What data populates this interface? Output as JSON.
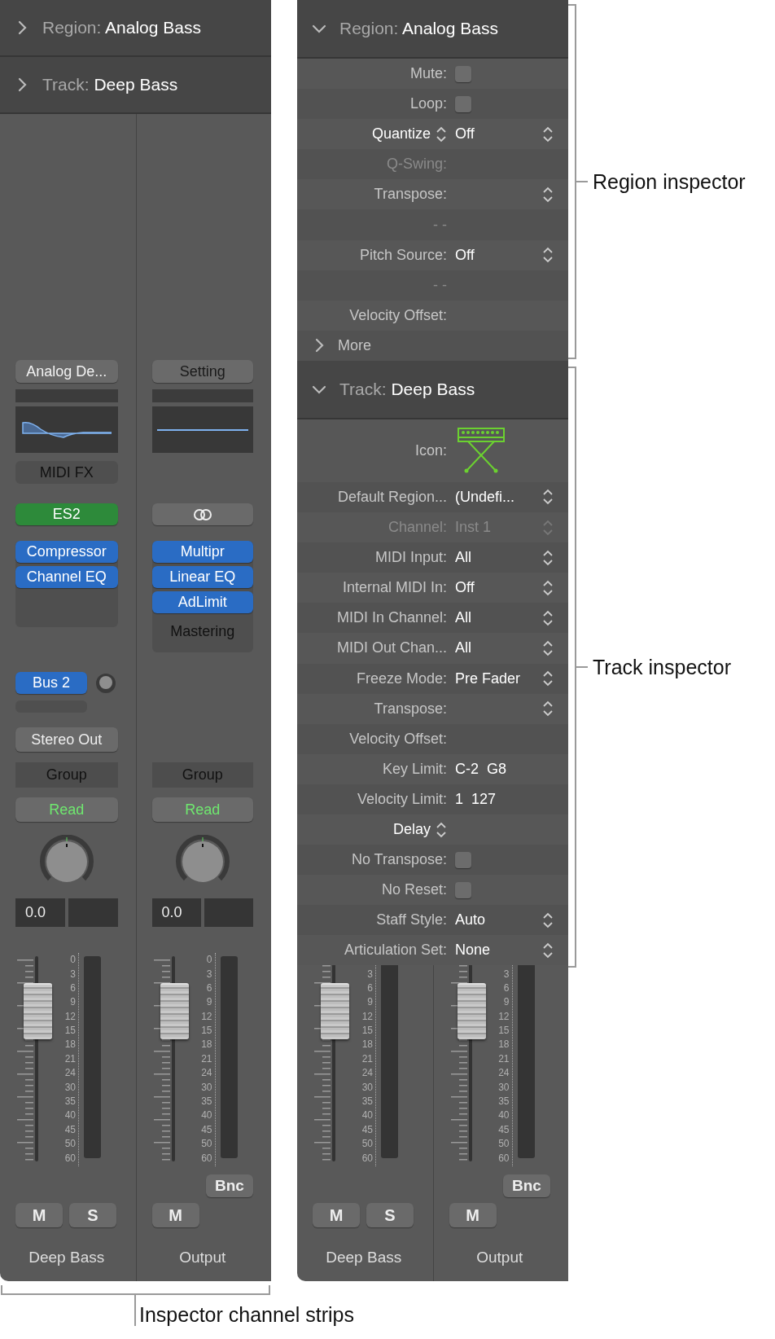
{
  "mixer_panel": {
    "headers": [
      {
        "label": "Region:",
        "title": "Analog Bass",
        "expanded": false
      },
      {
        "label": "Track:",
        "title": "Deep Bass",
        "expanded": false
      }
    ],
    "strips": [
      {
        "preset": {
          "label": "Analog De...",
          "active": true
        },
        "eq": {
          "kind": "curve"
        },
        "midi_fx": "MIDI FX",
        "instrument": {
          "kind": "plugin",
          "label": "ES2"
        },
        "audio_fx": [
          "Compressor",
          "Channel EQ"
        ],
        "send": "Bus 2",
        "output": "Stereo Out",
        "group": "Group",
        "automation": "Read",
        "volume": "0.0",
        "fader": {
          "level": 0.74,
          "scale": [
            "0",
            "3",
            "6",
            "9",
            "12",
            "15",
            "18",
            "21",
            "24",
            "30",
            "35",
            "40",
            "45",
            "50",
            "60"
          ]
        },
        "buttons": [
          "M",
          "S"
        ],
        "name": "Deep Bass"
      },
      {
        "preset": {
          "label": "Setting",
          "active": false
        },
        "eq": {
          "kind": "flat"
        },
        "instrument": {
          "kind": "link"
        },
        "audio_fx": [
          "Multipr",
          "Linear EQ",
          "AdLimit"
        ],
        "fx_footer": "Mastering",
        "group": "Group",
        "automation": "Read",
        "volume": "0.0",
        "fader": {
          "level": 0.74,
          "scale": [
            "0",
            "3",
            "6",
            "9",
            "12",
            "15",
            "18",
            "21",
            "24",
            "30",
            "35",
            "40",
            "45",
            "50",
            "60"
          ]
        },
        "bounce": "Bnc",
        "buttons": [
          "M"
        ],
        "name": "Output"
      }
    ]
  },
  "inspector_panel": {
    "sections": [
      {
        "label": "Region:",
        "title": "Analog Bass",
        "expanded": true,
        "rows": [
          {
            "kind": "checkbox",
            "label": "Mute:",
            "checked": false
          },
          {
            "kind": "checkbox",
            "label": "Loop:",
            "checked": false
          },
          {
            "kind": "label_popup",
            "label": "Quantize",
            "value": "Off"
          },
          {
            "kind": "text",
            "label": "Q-Swing:",
            "disabled": true
          },
          {
            "kind": "popup",
            "label": "Transpose:"
          },
          {
            "kind": "range",
            "label": "- -"
          },
          {
            "kind": "popup",
            "label": "Pitch Source:",
            "value": "Off"
          },
          {
            "kind": "range",
            "label": "- -"
          },
          {
            "kind": "text",
            "label": "Velocity Offset:"
          },
          {
            "kind": "disclosure",
            "label": "More",
            "expanded": false
          }
        ]
      },
      {
        "label": "Track:",
        "title": "Deep Bass",
        "expanded": true,
        "rows": [
          {
            "kind": "icon",
            "label": "Icon:"
          },
          {
            "kind": "popup",
            "label": "Default Region...",
            "value": "(Undefi..."
          },
          {
            "kind": "popup",
            "label": "Channel:",
            "value": "Inst 1",
            "disabled": true
          },
          {
            "kind": "popup",
            "label": "MIDI Input:",
            "value": "All"
          },
          {
            "kind": "popup",
            "label": "Internal MIDI In:",
            "value": "Off"
          },
          {
            "kind": "popup",
            "label": "MIDI In Channel:",
            "value": "All"
          },
          {
            "kind": "popup",
            "label": "MIDI Out Chan...",
            "value": "All"
          },
          {
            "kind": "popup",
            "label": "Freeze Mode:",
            "value": "Pre Fader"
          },
          {
            "kind": "popup",
            "label": "Transpose:"
          },
          {
            "kind": "text",
            "label": "Velocity Offset:"
          },
          {
            "kind": "text",
            "label": "Key Limit:",
            "value": "C-2  G8"
          },
          {
            "kind": "text",
            "label": "Velocity Limit:",
            "value": "1  127"
          },
          {
            "kind": "label_popup",
            "label": "Delay"
          },
          {
            "kind": "checkbox",
            "label": "No Transpose:",
            "checked": false
          },
          {
            "kind": "checkbox",
            "label": "No Reset:",
            "checked": false
          },
          {
            "kind": "popup",
            "label": "Staff Style:",
            "value": "Auto"
          },
          {
            "kind": "popup",
            "label": "Articulation Set:",
            "value": "None"
          }
        ]
      }
    ],
    "strips": [
      {
        "fader": {
          "level": 0.74,
          "scale": [
            "3",
            "6",
            "9",
            "12",
            "15",
            "18",
            "21",
            "24",
            "30",
            "35",
            "40",
            "45",
            "50",
            "60"
          ]
        },
        "buttons": [
          "M",
          "S"
        ],
        "name": "Deep Bass"
      },
      {
        "fader": {
          "level": 0.74,
          "scale": [
            "3",
            "6",
            "9",
            "12",
            "15",
            "18",
            "21",
            "24",
            "30",
            "35",
            "40",
            "45",
            "50",
            "60"
          ]
        },
        "bounce": "Bnc",
        "buttons": [
          "M"
        ],
        "name": "Output"
      }
    ]
  },
  "callouts": [
    {
      "text": "Region inspector"
    },
    {
      "text": "Track inspector"
    },
    {
      "text": "Inspector channel strips"
    }
  ]
}
